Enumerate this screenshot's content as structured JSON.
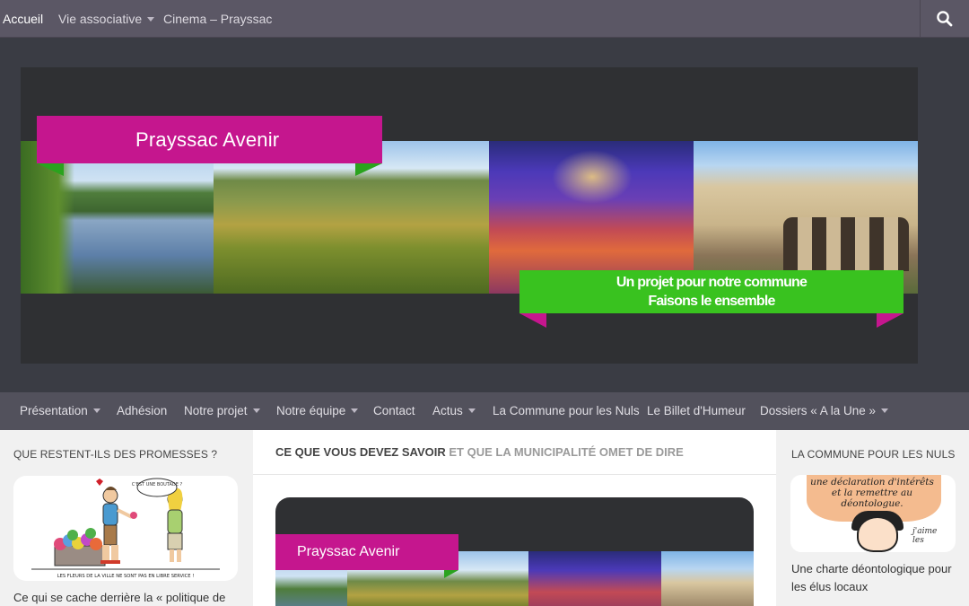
{
  "topnav": {
    "items": [
      {
        "label": "Accueil",
        "active": true,
        "has_dropdown": false
      },
      {
        "label": "Vie associative",
        "active": false,
        "has_dropdown": true
      },
      {
        "label": "Cinema – Prayssac",
        "active": false,
        "has_dropdown": false
      }
    ],
    "search_icon": "search-icon"
  },
  "header": {
    "banner_title": "Prayssac Avenir",
    "tagline_line1": "Un projet pour notre commune",
    "tagline_line2": "Faisons le ensemble",
    "colors": {
      "pink": "#c5168e",
      "green": "#39c21f",
      "dark_green": "#2aa31e"
    }
  },
  "mainnav": {
    "items": [
      {
        "label": "Présentation",
        "has_dropdown": true
      },
      {
        "label": "Adhésion",
        "has_dropdown": false
      },
      {
        "label": "Notre projet",
        "has_dropdown": true
      },
      {
        "label": "Notre équipe",
        "has_dropdown": true
      },
      {
        "label": "Contact",
        "has_dropdown": false
      },
      {
        "label": "Actus",
        "has_dropdown": true
      },
      {
        "label": "La Commune pour les Nuls",
        "has_dropdown": false
      },
      {
        "label": "Le Billet d'Humeur",
        "has_dropdown": false
      },
      {
        "label": "Dossiers « A la Une »",
        "has_dropdown": true
      }
    ]
  },
  "sidebar_left": {
    "title": "Que restent-ils des promesses ?",
    "cartoon_bubble": "C'EST UNE BOUTADE ?",
    "cartoon_caption": "LES FLEURS DE LA VILLE NE SONT PAS EN LIBRE SERVICE !",
    "post_title": "Ce qui se cache derrière la « politique de"
  },
  "main": {
    "heading_bold": "Ce que vous devez savoir",
    "heading_rest": "et que la municipalité omet de dire",
    "featured_banner_title": "Prayssac Avenir"
  },
  "sidebar_right": {
    "title": "La Commune pour les Nuls",
    "cartoon_text": "une déclaration d'intérêts et la remettre au déontologue.",
    "cartoon_signature": "j'aime les",
    "post_title": "Une charte déontologique pour les élus locaux"
  }
}
